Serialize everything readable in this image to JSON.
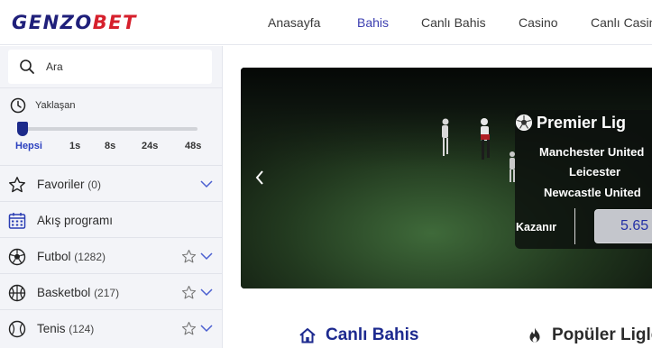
{
  "logo": {
    "part1": "GENZO",
    "part2": "BET"
  },
  "nav": [
    {
      "label": "Anasayfa",
      "active": false
    },
    {
      "label": "Bahis",
      "active": true
    },
    {
      "label": "Canlı Bahis",
      "active": false
    },
    {
      "label": "Casino",
      "active": false
    },
    {
      "label": "Canlı Casino",
      "active": false
    }
  ],
  "sidebar": {
    "search": {
      "placeholder": "Ara",
      "icon": "search-icon"
    },
    "time_filter": {
      "label": "Yaklaşan",
      "options": [
        "Hepsi",
        "1s",
        "8s",
        "24s",
        "48s"
      ],
      "selected": "Hepsi"
    },
    "items": [
      {
        "label": "Favoriler",
        "count": "(0)",
        "icon": "star-icon"
      },
      {
        "label": "Akış programı",
        "count": "",
        "icon": "calendar-icon"
      },
      {
        "label": "Futbol",
        "count": "(1282)",
        "icon": "soccer-ball-icon"
      },
      {
        "label": "Basketbol",
        "count": "(217)",
        "icon": "basketball-icon"
      },
      {
        "label": "Tenis",
        "count": "(124)",
        "icon": "tennis-ball-icon"
      }
    ]
  },
  "banner": {
    "league": "Premier Lig",
    "teams": [
      "Manchester United",
      "Leicester",
      "Newcastle United"
    ],
    "winner_label": "Kazanır",
    "odd": "5.65"
  },
  "sections": {
    "live_title": "Canlı Bahis",
    "popular_title": "Popüler Ligler"
  },
  "colors": {
    "brand_dark": "#1f1f7a",
    "brand_red": "#d6202c",
    "accent": "#3b3eb0",
    "sidebar_bg": "#f3f4f8"
  }
}
